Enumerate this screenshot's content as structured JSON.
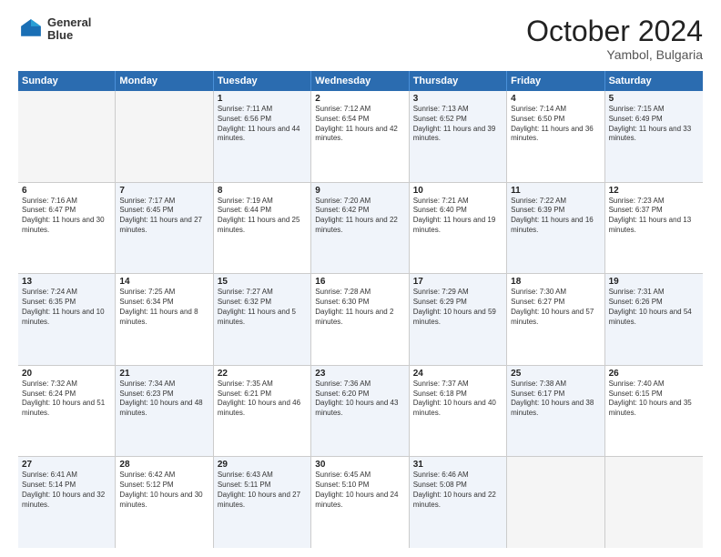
{
  "logo": {
    "line1": "General",
    "line2": "Blue"
  },
  "title": "October 2024",
  "subtitle": "Yambol, Bulgaria",
  "header_days": [
    "Sunday",
    "Monday",
    "Tuesday",
    "Wednesday",
    "Thursday",
    "Friday",
    "Saturday"
  ],
  "rows": [
    [
      {
        "day": "",
        "text": "",
        "empty": true
      },
      {
        "day": "",
        "text": "",
        "empty": true
      },
      {
        "day": "1",
        "text": "Sunrise: 7:11 AM\nSunset: 6:56 PM\nDaylight: 11 hours and 44 minutes.",
        "shaded": true
      },
      {
        "day": "2",
        "text": "Sunrise: 7:12 AM\nSunset: 6:54 PM\nDaylight: 11 hours and 42 minutes.",
        "shaded": false
      },
      {
        "day": "3",
        "text": "Sunrise: 7:13 AM\nSunset: 6:52 PM\nDaylight: 11 hours and 39 minutes.",
        "shaded": true
      },
      {
        "day": "4",
        "text": "Sunrise: 7:14 AM\nSunset: 6:50 PM\nDaylight: 11 hours and 36 minutes.",
        "shaded": false
      },
      {
        "day": "5",
        "text": "Sunrise: 7:15 AM\nSunset: 6:49 PM\nDaylight: 11 hours and 33 minutes.",
        "shaded": true
      }
    ],
    [
      {
        "day": "6",
        "text": "Sunrise: 7:16 AM\nSunset: 6:47 PM\nDaylight: 11 hours and 30 minutes.",
        "shaded": false
      },
      {
        "day": "7",
        "text": "Sunrise: 7:17 AM\nSunset: 6:45 PM\nDaylight: 11 hours and 27 minutes.",
        "shaded": true
      },
      {
        "day": "8",
        "text": "Sunrise: 7:19 AM\nSunset: 6:44 PM\nDaylight: 11 hours and 25 minutes.",
        "shaded": false
      },
      {
        "day": "9",
        "text": "Sunrise: 7:20 AM\nSunset: 6:42 PM\nDaylight: 11 hours and 22 minutes.",
        "shaded": true
      },
      {
        "day": "10",
        "text": "Sunrise: 7:21 AM\nSunset: 6:40 PM\nDaylight: 11 hours and 19 minutes.",
        "shaded": false
      },
      {
        "day": "11",
        "text": "Sunrise: 7:22 AM\nSunset: 6:39 PM\nDaylight: 11 hours and 16 minutes.",
        "shaded": true
      },
      {
        "day": "12",
        "text": "Sunrise: 7:23 AM\nSunset: 6:37 PM\nDaylight: 11 hours and 13 minutes.",
        "shaded": false
      }
    ],
    [
      {
        "day": "13",
        "text": "Sunrise: 7:24 AM\nSunset: 6:35 PM\nDaylight: 11 hours and 10 minutes.",
        "shaded": true
      },
      {
        "day": "14",
        "text": "Sunrise: 7:25 AM\nSunset: 6:34 PM\nDaylight: 11 hours and 8 minutes.",
        "shaded": false
      },
      {
        "day": "15",
        "text": "Sunrise: 7:27 AM\nSunset: 6:32 PM\nDaylight: 11 hours and 5 minutes.",
        "shaded": true
      },
      {
        "day": "16",
        "text": "Sunrise: 7:28 AM\nSunset: 6:30 PM\nDaylight: 11 hours and 2 minutes.",
        "shaded": false
      },
      {
        "day": "17",
        "text": "Sunrise: 7:29 AM\nSunset: 6:29 PM\nDaylight: 10 hours and 59 minutes.",
        "shaded": true
      },
      {
        "day": "18",
        "text": "Sunrise: 7:30 AM\nSunset: 6:27 PM\nDaylight: 10 hours and 57 minutes.",
        "shaded": false
      },
      {
        "day": "19",
        "text": "Sunrise: 7:31 AM\nSunset: 6:26 PM\nDaylight: 10 hours and 54 minutes.",
        "shaded": true
      }
    ],
    [
      {
        "day": "20",
        "text": "Sunrise: 7:32 AM\nSunset: 6:24 PM\nDaylight: 10 hours and 51 minutes.",
        "shaded": false
      },
      {
        "day": "21",
        "text": "Sunrise: 7:34 AM\nSunset: 6:23 PM\nDaylight: 10 hours and 48 minutes.",
        "shaded": true
      },
      {
        "day": "22",
        "text": "Sunrise: 7:35 AM\nSunset: 6:21 PM\nDaylight: 10 hours and 46 minutes.",
        "shaded": false
      },
      {
        "day": "23",
        "text": "Sunrise: 7:36 AM\nSunset: 6:20 PM\nDaylight: 10 hours and 43 minutes.",
        "shaded": true
      },
      {
        "day": "24",
        "text": "Sunrise: 7:37 AM\nSunset: 6:18 PM\nDaylight: 10 hours and 40 minutes.",
        "shaded": false
      },
      {
        "day": "25",
        "text": "Sunrise: 7:38 AM\nSunset: 6:17 PM\nDaylight: 10 hours and 38 minutes.",
        "shaded": true
      },
      {
        "day": "26",
        "text": "Sunrise: 7:40 AM\nSunset: 6:15 PM\nDaylight: 10 hours and 35 minutes.",
        "shaded": false
      }
    ],
    [
      {
        "day": "27",
        "text": "Sunrise: 6:41 AM\nSunset: 5:14 PM\nDaylight: 10 hours and 32 minutes.",
        "shaded": true
      },
      {
        "day": "28",
        "text": "Sunrise: 6:42 AM\nSunset: 5:12 PM\nDaylight: 10 hours and 30 minutes.",
        "shaded": false
      },
      {
        "day": "29",
        "text": "Sunrise: 6:43 AM\nSunset: 5:11 PM\nDaylight: 10 hours and 27 minutes.",
        "shaded": true
      },
      {
        "day": "30",
        "text": "Sunrise: 6:45 AM\nSunset: 5:10 PM\nDaylight: 10 hours and 24 minutes.",
        "shaded": false
      },
      {
        "day": "31",
        "text": "Sunrise: 6:46 AM\nSunset: 5:08 PM\nDaylight: 10 hours and 22 minutes.",
        "shaded": true
      },
      {
        "day": "",
        "text": "",
        "empty": true
      },
      {
        "day": "",
        "text": "",
        "empty": true
      }
    ]
  ]
}
